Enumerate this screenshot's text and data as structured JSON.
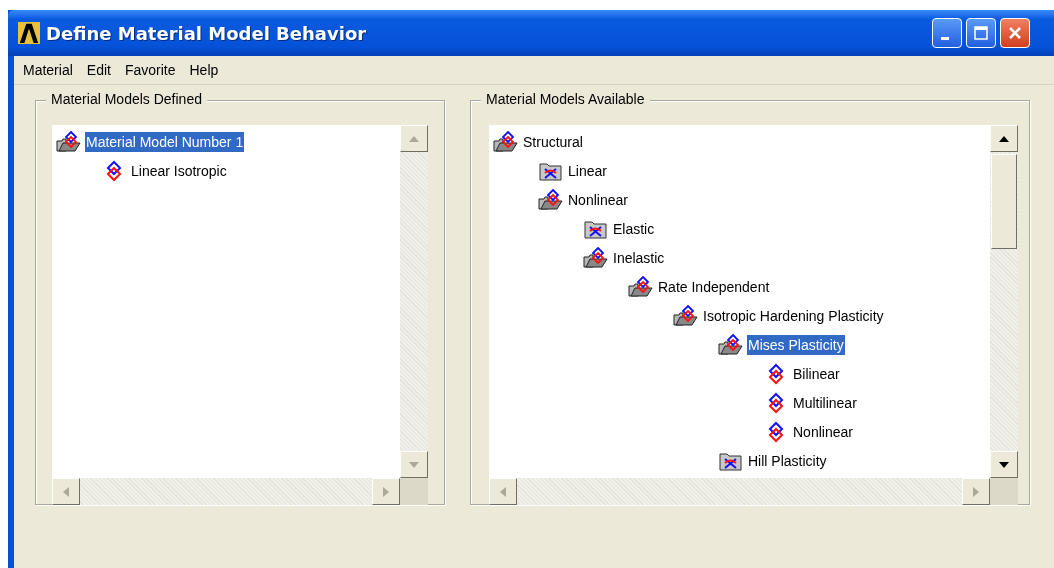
{
  "window": {
    "title": "Define Material Model Behavior"
  },
  "menu": [
    "Material",
    "Edit",
    "Favorite",
    "Help"
  ],
  "defined_panel": {
    "title": "Material Models Defined",
    "tree": [
      {
        "label": "Material Model Number 1",
        "kind": "folder",
        "expanded": true,
        "selected": true,
        "children": [
          {
            "label": "Linear Isotropic",
            "kind": "model",
            "selected": false
          }
        ]
      }
    ]
  },
  "available_panel": {
    "title": "Material Models Available",
    "tree": [
      {
        "label": "Structural",
        "kind": "folder",
        "expanded": true,
        "selected": false,
        "children": [
          {
            "label": "Linear",
            "kind": "folder",
            "expanded": false,
            "selected": false
          },
          {
            "label": "Nonlinear",
            "kind": "folder",
            "expanded": true,
            "selected": false,
            "children": [
              {
                "label": "Elastic",
                "kind": "folder",
                "expanded": false,
                "selected": false
              },
              {
                "label": "Inelastic",
                "kind": "folder",
                "expanded": true,
                "selected": false,
                "children": [
                  {
                    "label": "Rate Independent",
                    "kind": "folder",
                    "expanded": true,
                    "selected": false,
                    "children": [
                      {
                        "label": "Isotropic Hardening Plasticity",
                        "kind": "folder",
                        "expanded": true,
                        "selected": false,
                        "children": [
                          {
                            "label": "Mises Plasticity",
                            "kind": "folder",
                            "expanded": true,
                            "selected": true,
                            "children": [
                              {
                                "label": "Bilinear",
                                "kind": "model",
                                "selected": false
                              },
                              {
                                "label": "Multilinear",
                                "kind": "model",
                                "selected": false
                              },
                              {
                                "label": "Nonlinear",
                                "kind": "model",
                                "selected": false
                              }
                            ]
                          },
                          {
                            "label": "Hill Plasticity",
                            "kind": "folder",
                            "expanded": false,
                            "selected": false
                          }
                        ]
                      }
                    ]
                  }
                ]
              }
            ]
          }
        ]
      }
    ]
  }
}
